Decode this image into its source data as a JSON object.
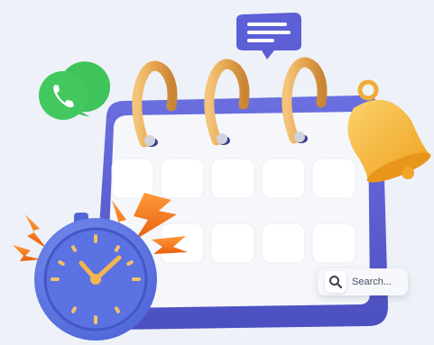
{
  "search": {
    "label": "Search...",
    "icon": "search-icon"
  },
  "illustration": {
    "icons": [
      "calendar-icon",
      "alarm-clock-icon",
      "bell-icon",
      "phone-chat-icon",
      "message-bubble-icon"
    ]
  },
  "colors": {
    "background": "#eef1f8",
    "calendar_frame": "#5b5ecf",
    "calendar_sheet": "#f6f7fb",
    "ring_gold": "#e9b15a",
    "clock_body": "#5f78e6",
    "bell_yellow": "#f6b73c",
    "phone_green": "#3fc35b",
    "bolt_orange": "#f07a1c"
  }
}
